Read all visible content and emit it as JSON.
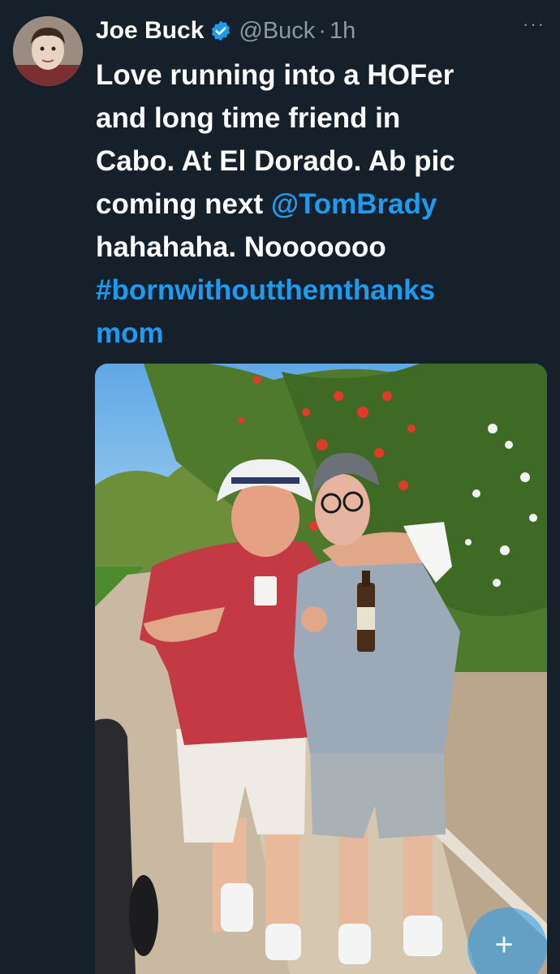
{
  "tweet": {
    "author_name": "Joe Buck",
    "handle": "@Buck",
    "separator": "·",
    "time": "1h",
    "more_label": "···",
    "text_segments": [
      {
        "id": "l1",
        "text": "Love running into a HOFer"
      },
      {
        "id": "l2",
        "text": "and long time friend in"
      },
      {
        "id": "l3",
        "text": "Cabo.  At El Dorado. Ab pic"
      },
      {
        "id": "l4a",
        "text": "coming next "
      },
      {
        "id": "l4b",
        "text": "@TomBrady"
      },
      {
        "id": "l5",
        "text": "hahahaha. Nooooooo"
      },
      {
        "id": "l6",
        "text": "#bornwithoutthemthanks"
      },
      {
        "id": "l7",
        "text": "mom"
      }
    ],
    "mention": "@TomBrady",
    "hashtag": "#bornwithoutthemthanksmom"
  },
  "icons": {
    "verified": "verified-badge-icon",
    "more": "more-options-icon",
    "compose": "plus-icon"
  },
  "compose_button": {
    "label": "+"
  },
  "colors": {
    "background": "#15202b",
    "text": "#ffffff",
    "secondary": "#8b98a5",
    "link": "#1d9bf0"
  }
}
